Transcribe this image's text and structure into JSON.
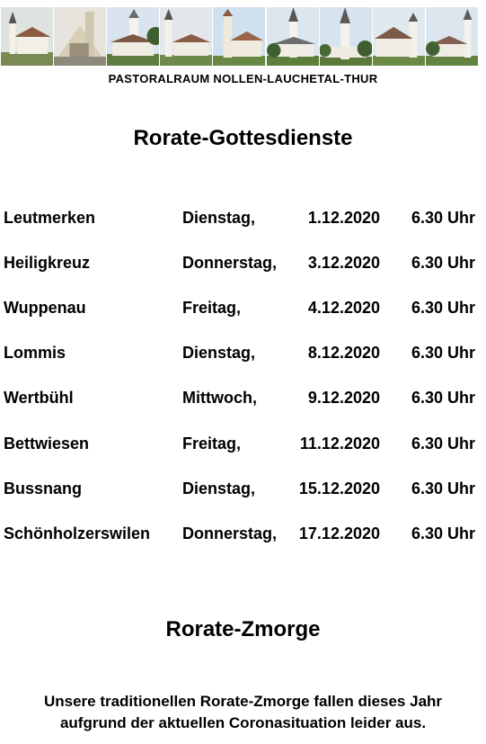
{
  "banner": {
    "photos": [
      {
        "name": "church-photo-1"
      },
      {
        "name": "church-photo-2"
      },
      {
        "name": "church-photo-3"
      },
      {
        "name": "church-photo-4"
      },
      {
        "name": "church-photo-5"
      },
      {
        "name": "church-photo-6"
      },
      {
        "name": "church-photo-7"
      },
      {
        "name": "church-photo-8"
      },
      {
        "name": "church-photo-9"
      }
    ]
  },
  "organization": "PASTORALRAUM NOLLEN-LAUCHETAL-THUR",
  "title": "Rorate-Gottesdienste",
  "services": [
    {
      "place": "Leutmerken",
      "day": "Dienstag,",
      "date": "1.12.2020",
      "time": "6.30 Uhr"
    },
    {
      "place": "Heiligkreuz",
      "day": "Donnerstag,",
      "date": "3.12.2020",
      "time": "6.30 Uhr"
    },
    {
      "place": "Wuppenau",
      "day": "Freitag,",
      "date": "4.12.2020",
      "time": "6.30 Uhr"
    },
    {
      "place": "Lommis",
      "day": "Dienstag,",
      "date": "8.12.2020",
      "time": "6.30 Uhr"
    },
    {
      "place": "Wertbühl",
      "day": "Mittwoch,",
      "date": "9.12.2020",
      "time": "6.30 Uhr"
    },
    {
      "place": "Bettwiesen",
      "day": "Freitag,",
      "date": "11.12.2020",
      "time": "6.30 Uhr"
    },
    {
      "place": "Bussnang",
      "day": "Dienstag,",
      "date": "15.12.2020",
      "time": "6.30 Uhr"
    },
    {
      "place": "Schönholzerswilen",
      "day": "Donnerstag,",
      "date": "17.12.2020",
      "time": "6.30 Uhr"
    }
  ],
  "subtitle": "Rorate-Zmorge",
  "note": {
    "line1": "Unsere traditionellen Rorate-Zmorge fallen dieses Jahr",
    "line2": "aufgrund der aktuellen Coronasituation leider aus."
  }
}
